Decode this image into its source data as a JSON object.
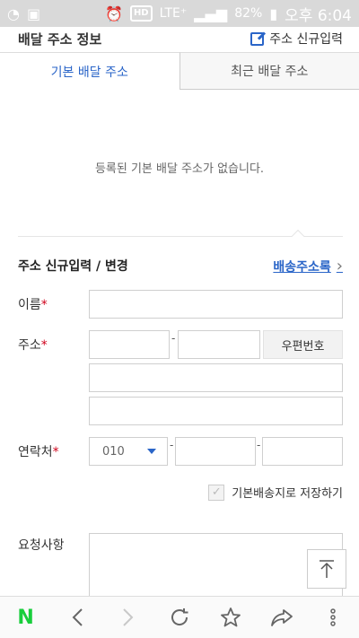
{
  "statusbar": {
    "hd": "HD",
    "lte": "LTE⁺",
    "battery": "82%",
    "time": "오후 6:04"
  },
  "header": {
    "title": "배달 주소 정보",
    "new_address": "주소 신규입력"
  },
  "tabs": [
    {
      "label": "기본 배달 주소",
      "active": true
    },
    {
      "label": "최근 배달 주소",
      "active": false
    }
  ],
  "empty_message": "등록된 기본 배달 주소가 없습니다.",
  "form": {
    "section_title": "주소 신규입력 / 변경",
    "address_book_link": "배송주소록",
    "name_label": "이름",
    "address_label": "주소",
    "zip_button": "우편번호",
    "phone_label": "연락처",
    "phone_prefix": "010",
    "required_mark": "*",
    "dash": "-",
    "save_default_label": "기본배송지로 저장하기",
    "request_label": "요청사항"
  },
  "bottom_nav": {
    "logo": "N"
  }
}
